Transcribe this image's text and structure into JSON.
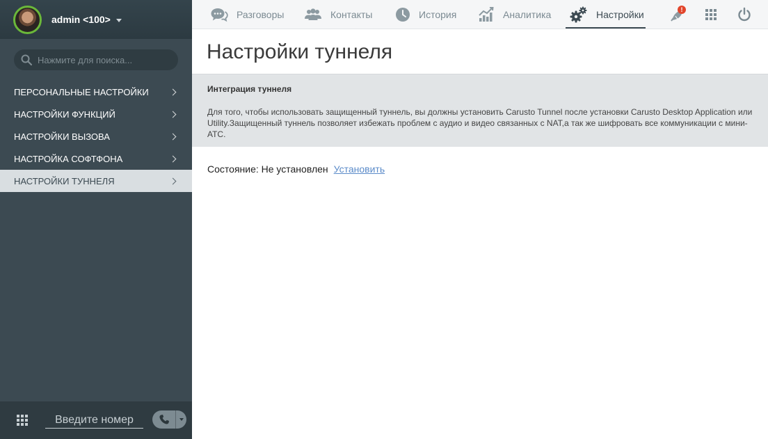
{
  "user": {
    "name": "admin <100>"
  },
  "search": {
    "placeholder": "Нажмите для поиска..."
  },
  "sidebar": {
    "items": [
      {
        "label": "ПЕРСОНАЛЬНЫЕ НАСТРОЙКИ",
        "active": false
      },
      {
        "label": "НАСТРОЙКИ ФУНКЦИЙ",
        "active": false
      },
      {
        "label": "НАСТРОЙКИ ВЫЗОВА",
        "active": false
      },
      {
        "label": "НАСТРОЙКА СОФТФОНА",
        "active": false
      },
      {
        "label": "НАСТРОЙКИ ТУННЕЛЯ",
        "active": true
      }
    ]
  },
  "nav": {
    "tabs": [
      {
        "label": "Разговоры",
        "icon": "chat-icon"
      },
      {
        "label": "Контакты",
        "icon": "contacts-icon"
      },
      {
        "label": "История",
        "icon": "clock-icon"
      },
      {
        "label": "Аналитика",
        "icon": "analytics-icon"
      },
      {
        "label": "Настройки",
        "icon": "gears-icon",
        "active": true
      }
    ],
    "notification_badge": "!"
  },
  "content": {
    "title": "Настройки туннеля",
    "panel_title": "Интеграция туннеля",
    "panel_text": "Для того, чтобы использовать защищенный туннель, вы должны установить Carusto Tunnel после установки Carusto Desktop Application или Utility.Защищенный туннель позволяет избежать проблем с аудио и видео связанных с NAT,а так же шифровать все коммуникации с мини-АТС.",
    "status_label": "Состояние: Не установлен",
    "install_link": "Установить"
  },
  "dialer": {
    "placeholder": "Введите номер"
  },
  "colors": {
    "sidebar": "#3c4a52",
    "active_item": "#d9dee1",
    "link": "#5b8bc9",
    "badge": "#e2452b",
    "avatar_ring": "#6bb83a"
  }
}
